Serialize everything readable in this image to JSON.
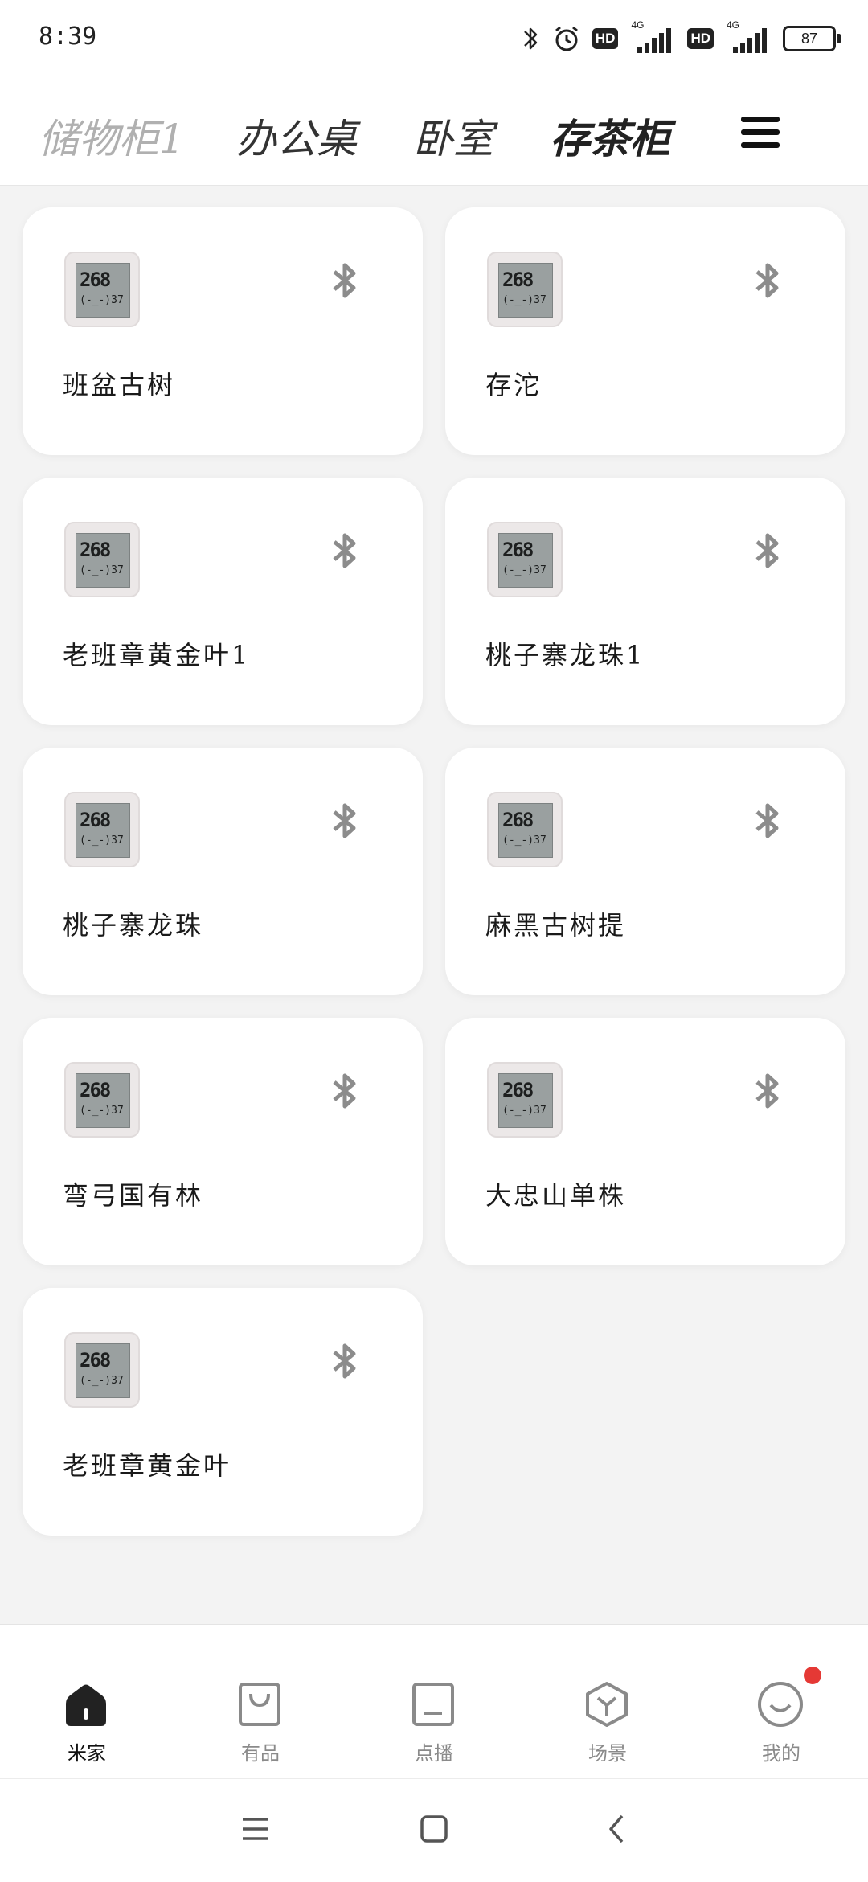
{
  "status_bar": {
    "time": "8:39",
    "hd1": "HD",
    "hd2": "HD",
    "net1": "4G",
    "net2": "4G",
    "battery": "87"
  },
  "header": {
    "tabs": [
      "储物柜1",
      "办公桌",
      "卧室",
      "存茶柜"
    ],
    "active_tab": "存茶柜",
    "menu_icon": "menu-icon"
  },
  "devices": [
    {
      "name": "班盆古树",
      "display_top": "268",
      "display_bottom": "(-_-)37",
      "icon": "bluetooth-icon"
    },
    {
      "name": "存沱",
      "display_top": "268",
      "display_bottom": "(-_-)37",
      "icon": "bluetooth-icon"
    },
    {
      "name": "老班章黄金叶1",
      "display_top": "268",
      "display_bottom": "(-_-)37",
      "icon": "bluetooth-icon"
    },
    {
      "name": "桃子寨龙珠1",
      "display_top": "268",
      "display_bottom": "(-_-)37",
      "icon": "bluetooth-icon"
    },
    {
      "name": "桃子寨龙珠",
      "display_top": "268",
      "display_bottom": "(-_-)37",
      "icon": "bluetooth-icon"
    },
    {
      "name": "麻黑古树提",
      "display_top": "268",
      "display_bottom": "(-_-)37",
      "icon": "bluetooth-icon"
    },
    {
      "name": "弯弓国有林",
      "display_top": "268",
      "display_bottom": "(-_-)37",
      "icon": "bluetooth-icon"
    },
    {
      "name": "大忠山单株",
      "display_top": "268",
      "display_bottom": "(-_-)37",
      "icon": "bluetooth-icon"
    },
    {
      "name": "老班章黄金叶",
      "display_top": "268",
      "display_bottom": "(-_-)37",
      "icon": "bluetooth-icon"
    }
  ],
  "bottom_nav": {
    "items": [
      {
        "label": "米家",
        "icon": "home-icon",
        "active": true
      },
      {
        "label": "有品",
        "icon": "shopping-bag-icon",
        "active": false
      },
      {
        "label": "点播",
        "icon": "media-icon",
        "active": false
      },
      {
        "label": "场景",
        "icon": "scene-hexagon-icon",
        "active": false
      },
      {
        "label": "我的",
        "icon": "profile-smile-icon",
        "active": false,
        "badge": true
      }
    ]
  },
  "system_nav": [
    "menu-icon",
    "home-square-icon",
    "back-icon"
  ],
  "colors": {
    "accent": "#e53935",
    "card": "#ffffff",
    "background": "#f3f3f3"
  }
}
